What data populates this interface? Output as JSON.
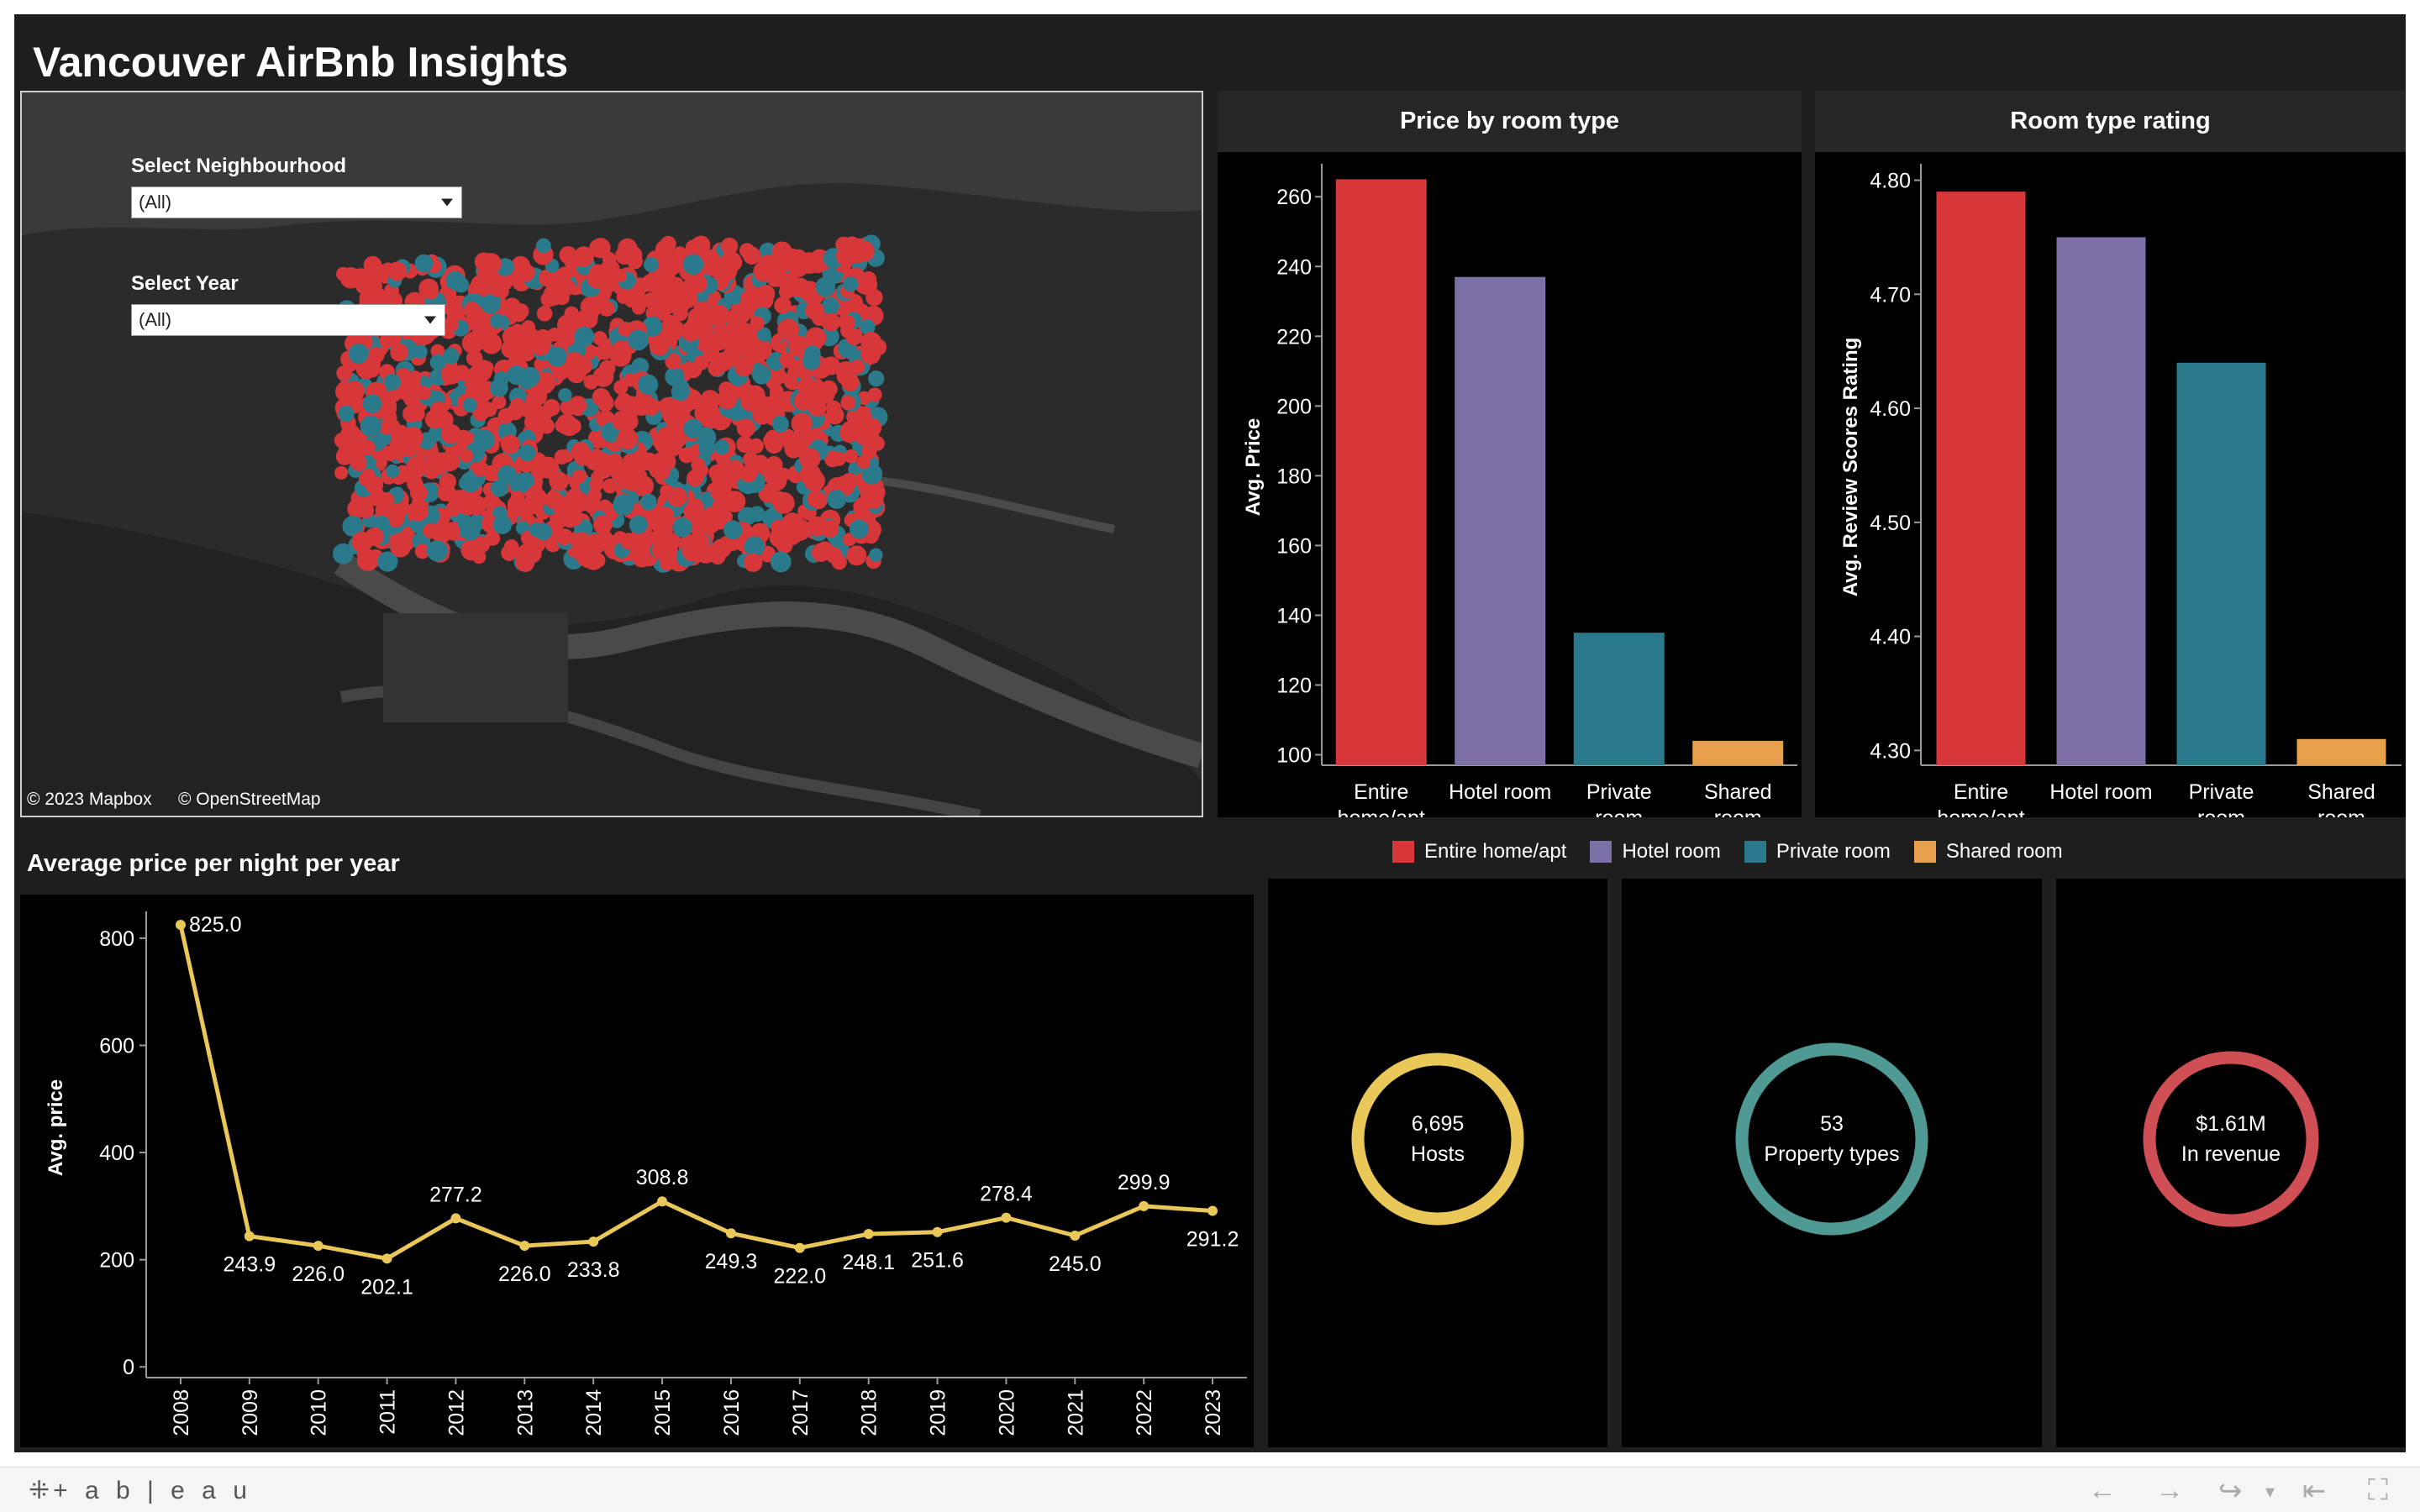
{
  "dashboard": {
    "title": "Vancouver AirBnb Insights"
  },
  "filters": {
    "neighbourhood": {
      "label": "Select Neighbourhood",
      "value": "(All)"
    },
    "year": {
      "label": "Select Year",
      "value": "(All)"
    }
  },
  "map": {
    "credit_mapbox": "© 2023 Mapbox",
    "credit_osm": "© OpenStreetMap"
  },
  "colors": {
    "entire": "#d8373a",
    "hotel": "#7c70a7",
    "private": "#2b7a8b",
    "shared": "#e8a04c",
    "line": "#e9c759"
  },
  "price_chart": {
    "title": "Price by room type",
    "chart_data": {
      "type": "bar",
      "categories": [
        "Entire home/apt",
        "Hotel room",
        "Private room",
        "Shared room"
      ],
      "values": [
        265,
        237,
        135,
        104
      ],
      "ylabel": "Avg. Price",
      "ylim": [
        97,
        268
      ],
      "yticks": [
        "100",
        "120",
        "140",
        "160",
        "180",
        "200",
        "220",
        "240",
        "260"
      ]
    },
    "tick_lines": [
      [
        "Entire",
        "home/apt"
      ],
      [
        "Hotel room"
      ],
      [
        "Private",
        "room"
      ],
      [
        "Shared",
        "room"
      ]
    ]
  },
  "rating_chart": {
    "title": "Room type rating",
    "chart_data": {
      "type": "bar",
      "categories": [
        "Entire home/apt",
        "Hotel room",
        "Private room",
        "Shared room"
      ],
      "values": [
        4.79,
        4.75,
        4.64,
        4.31
      ],
      "ylabel": "Avg. Review Scores Rating",
      "ylim": [
        4.287,
        4.81
      ],
      "yticks": [
        "4.30",
        "4.40",
        "4.50",
        "4.60",
        "4.70",
        "4.80"
      ]
    },
    "tick_lines": [
      [
        "Entire",
        "home/apt"
      ],
      [
        "Hotel room"
      ],
      [
        "Private",
        "room"
      ],
      [
        "Shared",
        "room"
      ]
    ]
  },
  "line_chart": {
    "title": "Average price per night per year",
    "chart_data": {
      "type": "line",
      "x": [
        "2008",
        "2009",
        "2010",
        "2011",
        "2012",
        "2013",
        "2014",
        "2015",
        "2016",
        "2017",
        "2018",
        "2019",
        "2020",
        "2021",
        "2022",
        "2023"
      ],
      "y": [
        825.0,
        243.9,
        226.0,
        202.1,
        277.2,
        226.0,
        233.8,
        308.8,
        249.3,
        222.0,
        248.1,
        251.6,
        278.4,
        245.0,
        299.9,
        291.2
      ],
      "labels": [
        "825.0",
        "243.9",
        "226.0",
        "202.1",
        "277.2",
        "226.0",
        "233.8",
        "308.8",
        "249.3",
        "222.0",
        "248.1",
        "251.6",
        "278.4",
        "245.0",
        "299.9",
        "291.2"
      ],
      "ylabel": "Avg. price",
      "ylim": [
        -20,
        850
      ],
      "yticks": [
        "0",
        "200",
        "400",
        "600",
        "800"
      ]
    }
  },
  "legend": [
    {
      "label": "Entire home/apt",
      "color": "#d8373a"
    },
    {
      "label": "Hotel room",
      "color": "#7c70a7"
    },
    {
      "label": "Private room",
      "color": "#2b7a8b"
    },
    {
      "label": "Shared room",
      "color": "#e8a04c"
    }
  ],
  "kpis": [
    {
      "value": "6,695",
      "label": "Hosts",
      "color": "#e9c759"
    },
    {
      "value": "53",
      "label": "Property types",
      "color": "#4f9a94"
    },
    {
      "value": "$1.61M",
      "label": "In revenue",
      "color": "#cf4f55"
    }
  ],
  "footer": {
    "logo": "+ a b | e a u"
  }
}
